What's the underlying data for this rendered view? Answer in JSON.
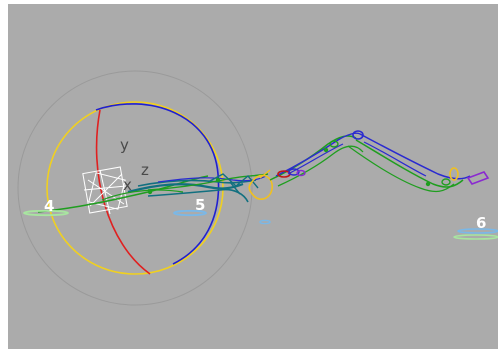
{
  "viewport": {
    "background": "#ababab",
    "gizmo": {
      "axis_labels": {
        "y": "y",
        "z": "z",
        "x": "x"
      },
      "colors": {
        "outer_ring": "#9a9a9a",
        "ring_x": "#e02020",
        "ring_y": "#f0d020",
        "ring_z": "#2020d0",
        "handle_box": "#ffffff"
      }
    },
    "markers": [
      {
        "name": "marker-4",
        "label": "4"
      },
      {
        "name": "marker-5",
        "label": "5"
      },
      {
        "name": "marker-6",
        "label": "6"
      }
    ],
    "rig_colors": {
      "green": "#1f9e1f",
      "blue": "#2a2ad0",
      "teal": "#127080",
      "orange": "#f0c020",
      "purple": "#8a2ad0",
      "red": "#c01818",
      "light_blue": "#7ab8e8",
      "light_green": "#a8e6a0"
    }
  }
}
